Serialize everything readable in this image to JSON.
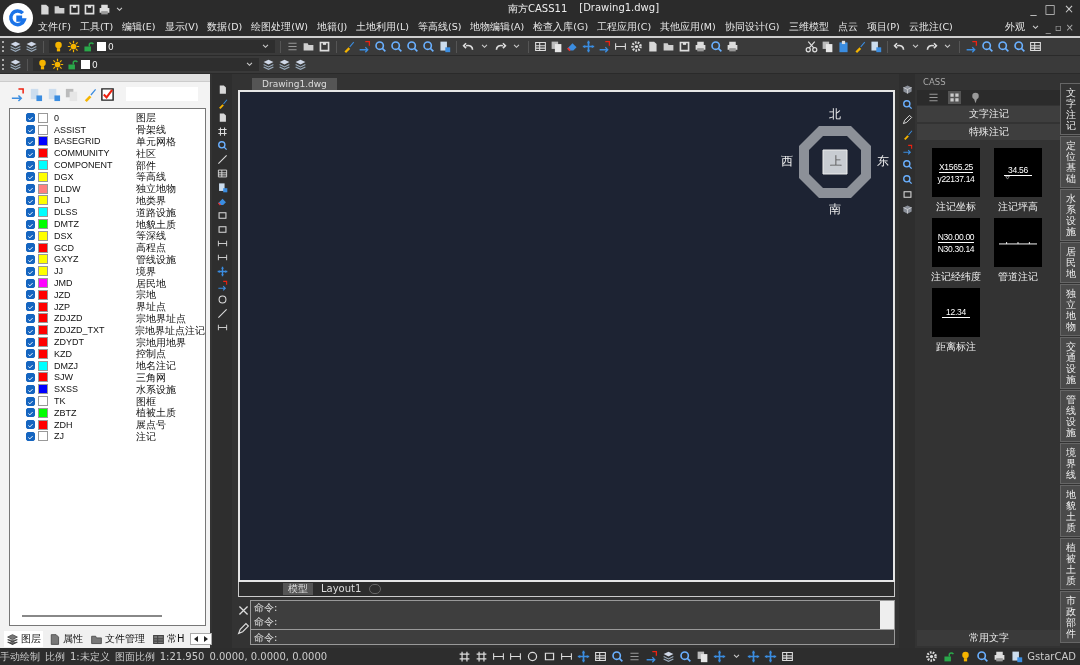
{
  "window": {
    "title": "南方CASS11",
    "document": "[Drawing1.dwg]",
    "controls": [
      "_",
      "□",
      "×"
    ]
  },
  "menu": {
    "items": [
      "文件(F)",
      "工具(T)",
      "编辑(E)",
      "显示(V)",
      "数据(D)",
      "绘图处理(W)",
      "地籍(J)",
      "土地利用(L)",
      "等高线(S)",
      "地物编辑(A)",
      "检查入库(G)",
      "工程应用(C)",
      "其他应用(M)",
      "协同设计(G)",
      "三维模型",
      "点云",
      "项目(P)",
      "云批注(C)"
    ],
    "appearance": "外观",
    "mdi_controls": [
      "_",
      "▫",
      "×"
    ]
  },
  "layer_combos": [
    {
      "value": "0"
    },
    {
      "value": "0"
    }
  ],
  "layer_panel": {
    "layers": [
      {
        "name": "0",
        "description": "图层",
        "color": "#ffffff",
        "visible": true
      },
      {
        "name": "ASSIST",
        "description": "骨架线",
        "color": "#ffffff",
        "visible": true
      },
      {
        "name": "BASEGRID",
        "description": "单元网格",
        "color": "#0000ff",
        "visible": true
      },
      {
        "name": "COMMUNITY",
        "description": "社区",
        "color": "#ff0000",
        "visible": true
      },
      {
        "name": "COMPONENT",
        "description": "部件",
        "color": "#00ffff",
        "visible": true
      },
      {
        "name": "DGX",
        "description": "等高线",
        "color": "#ffff00",
        "visible": true
      },
      {
        "name": "DLDW",
        "description": "独立地物",
        "color": "#ff8080",
        "visible": true
      },
      {
        "name": "DLJ",
        "description": "地类界",
        "color": "#ffff00",
        "visible": true
      },
      {
        "name": "DLSS",
        "description": "道路设施",
        "color": "#00ffff",
        "visible": true
      },
      {
        "name": "DMTZ",
        "description": "地貌土质",
        "color": "#00ff00",
        "visible": true
      },
      {
        "name": "DSX",
        "description": "等深线",
        "color": "#ffff00",
        "visible": true
      },
      {
        "name": "GCD",
        "description": "高程点",
        "color": "#ff0000",
        "visible": true
      },
      {
        "name": "GXYZ",
        "description": "管线设施",
        "color": "#ffff00",
        "visible": true
      },
      {
        "name": "JJ",
        "description": "境界",
        "color": "#ffff00",
        "visible": true
      },
      {
        "name": "JMD",
        "description": "居民地",
        "color": "#ff00ff",
        "visible": true
      },
      {
        "name": "JZD",
        "description": "宗地",
        "color": "#ff0000",
        "visible": true
      },
      {
        "name": "JZP",
        "description": "界址点",
        "color": "#ff0000",
        "visible": true
      },
      {
        "name": "ZDJZD",
        "description": "宗地界址点",
        "color": "#ff0000",
        "visible": true
      },
      {
        "name": "ZDJZD_TXT",
        "description": "宗地界址点注记",
        "color": "#ff0000",
        "visible": true
      },
      {
        "name": "ZDYDT",
        "description": "宗地用地界",
        "color": "#ff0000",
        "visible": true
      },
      {
        "name": "KZD",
        "description": "控制点",
        "color": "#ff0000",
        "visible": true
      },
      {
        "name": "DMZJ",
        "description": "地名注记",
        "color": "#00ffff",
        "visible": true
      },
      {
        "name": "SJW",
        "description": "三角网",
        "color": "#ff0000",
        "visible": true
      },
      {
        "name": "SXSS",
        "description": "水系设施",
        "color": "#0000ff",
        "visible": true
      },
      {
        "name": "TK",
        "description": "图框",
        "color": "#ffffff",
        "visible": true
      },
      {
        "name": "ZBTZ",
        "description": "植被土质",
        "color": "#00ff00",
        "visible": true
      },
      {
        "name": "ZDH",
        "description": "展点号",
        "color": "#ff0000",
        "visible": true
      },
      {
        "name": "ZJ",
        "description": "注记",
        "color": "#ffffff",
        "visible": true
      }
    ],
    "tabs": [
      {
        "label": "图层",
        "selected": true
      },
      {
        "label": "属性",
        "selected": false
      },
      {
        "label": "文件管理",
        "selected": false
      },
      {
        "label": "常H",
        "selected": false
      }
    ]
  },
  "file_tab": {
    "label": "Drawing1.dwg",
    "selected": true
  },
  "compass": {
    "north": "北",
    "south": "南",
    "east": "东",
    "west": "西",
    "top": "上"
  },
  "layout_tabs": [
    {
      "label": "模型",
      "selected": true
    },
    {
      "label": "Layout1",
      "selected": false
    }
  ],
  "command_lines": [
    "命令:",
    "命令:"
  ],
  "command_input": {
    "placeholder": "命令:"
  },
  "right_panel": {
    "title": "CASS",
    "sections": [
      {
        "label": "文字注记"
      },
      {
        "label": "特殊注记"
      }
    ],
    "items": [
      {
        "label": "注记坐标",
        "kind": "stacked",
        "preview": [
          "X1565.25",
          "y22137.14"
        ]
      },
      {
        "label": "注记坪高",
        "kind": "triangle",
        "preview": [
          "34.56"
        ]
      },
      {
        "label": "注记经纬度",
        "kind": "stacked",
        "preview": [
          "N30.00.00",
          "N30.30.14"
        ]
      },
      {
        "label": "管道注记",
        "kind": "ticks"
      },
      {
        "label": "距离标注",
        "kind": "line",
        "preview": [
          "12.34"
        ]
      }
    ],
    "footer": "常用文字",
    "side_tabs": [
      {
        "label": "文字注记",
        "selected": true
      },
      {
        "label": "定位基础",
        "selected": false
      },
      {
        "label": "水系设施",
        "selected": false
      },
      {
        "label": "居民地",
        "selected": false
      },
      {
        "label": "独立地物",
        "selected": false
      },
      {
        "label": "交通设施",
        "selected": false
      },
      {
        "label": "管线设施",
        "selected": false
      },
      {
        "label": "境界线",
        "selected": false
      },
      {
        "label": "地貌土质",
        "selected": false
      },
      {
        "label": "植被土质",
        "selected": false
      },
      {
        "label": "市政部件",
        "selected": false
      }
    ]
  },
  "status_bar": {
    "mode": "手动绘制",
    "scale_label": "比例",
    "scale": "1:未定义",
    "drawing_scale_label": "图面比例",
    "drawing_scale": "1:21.950",
    "coordinates": "0.0000, 0.0000, 0.0000",
    "brand": "GstarCAD"
  }
}
